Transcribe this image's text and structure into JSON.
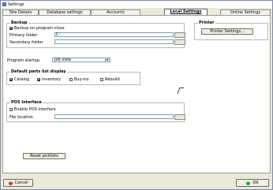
{
  "window": {
    "title": "Settings"
  },
  "tabs": [
    {
      "label": "Site Details",
      "active": false
    },
    {
      "label": "Database settings",
      "active": false
    },
    {
      "label": "Accounts",
      "active": false
    },
    {
      "label": "Local Settings",
      "active": true
    },
    {
      "label": "Online Settings",
      "active": false
    }
  ],
  "backup": {
    "title": "Backup",
    "backup_on_close_label": "Backup on program close",
    "backup_on_close_checked": true,
    "primary_folder_label": "Primary folder",
    "primary_folder_value": "C:",
    "secondary_folder_label": "Secondary folder",
    "secondary_folder_value": ""
  },
  "printer": {
    "title": "Printer",
    "settings_button": "Printer Settings..."
  },
  "program_startup": {
    "label": "Program startup:",
    "selected": "Job view"
  },
  "default_parts": {
    "title": "Default parts list display",
    "options": [
      {
        "label": "Catalog",
        "checked": true
      },
      {
        "label": "Inventory",
        "checked": true
      },
      {
        "label": "Buy-ins",
        "checked": false
      },
      {
        "label": "Rebuild",
        "checked": false
      }
    ]
  },
  "pos": {
    "title": "POS Interface",
    "enable_label": "Enable POS interface",
    "enable_checked": false,
    "file_location_label": "File location",
    "file_location_value": ""
  },
  "reset_button": "Reset picklists",
  "footer": {
    "cancel_label": "Cancel",
    "ok_label": "OK"
  }
}
